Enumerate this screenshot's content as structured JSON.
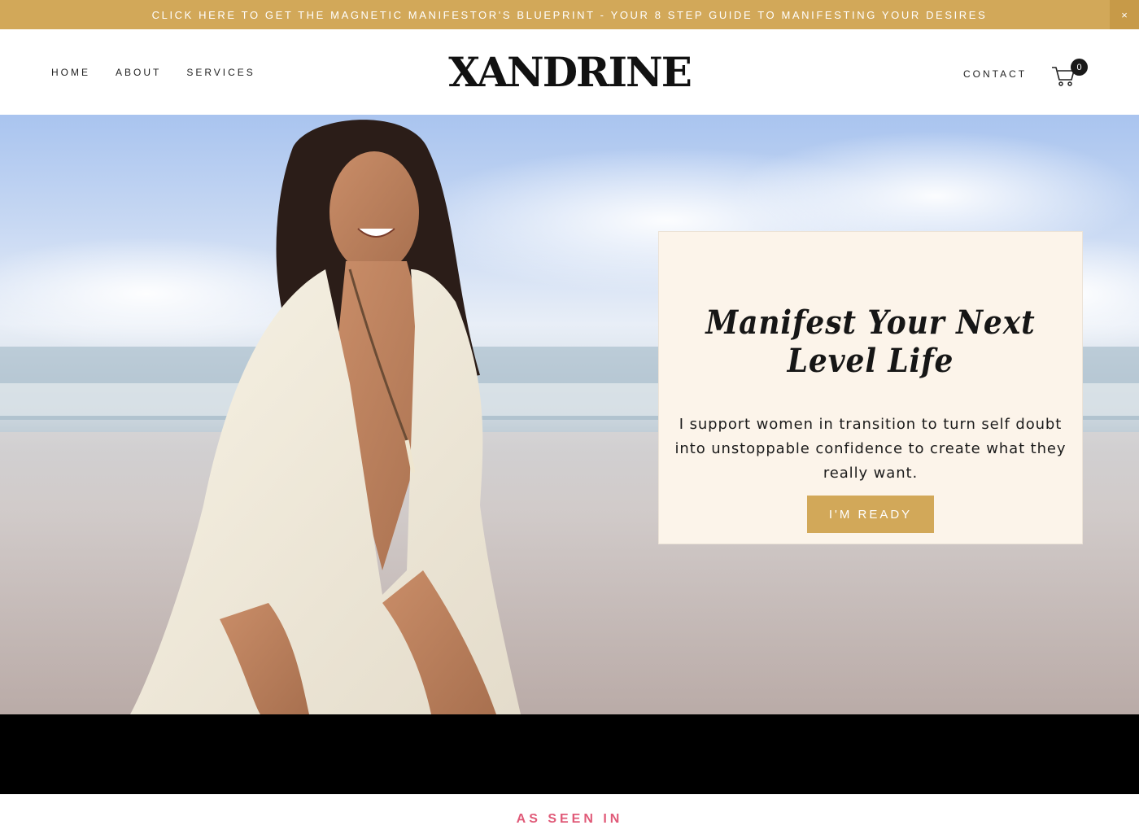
{
  "announcement": {
    "text": "CLICK HERE TO GET THE MAGNETIC MANIFESTOR'S BLUEPRINT - YOUR 8 STEP GUIDE TO MANIFESTING YOUR DESIRES",
    "close_label": "×",
    "color": "#d2a859"
  },
  "header": {
    "nav_left": [
      {
        "label": "HOME"
      },
      {
        "label": "ABOUT"
      },
      {
        "label": "SERVICES"
      }
    ],
    "logo_text": "XANDRINE",
    "nav_right": [
      {
        "label": "CONTACT"
      }
    ],
    "cart": {
      "icon": "cart-icon",
      "count": "0"
    }
  },
  "hero": {
    "title": "Manifest Your Next Level Life",
    "text": "I support women in transition to turn self doubt into unstoppable confidence to create what they really want.",
    "button_label": "I'M READY",
    "card_color": "#fcf4ea",
    "button_color": "#d2a859"
  },
  "seen_in": {
    "heading": "AS SEEN IN",
    "color": "#e05a78"
  }
}
